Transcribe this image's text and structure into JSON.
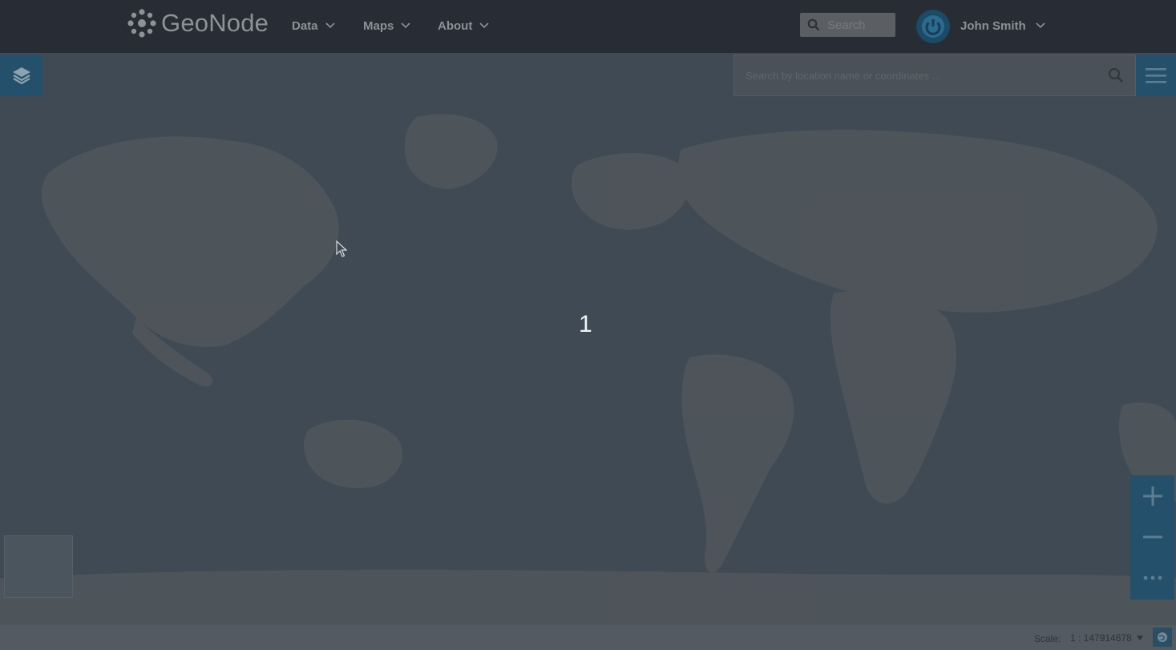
{
  "header": {
    "brand": "GeoNode",
    "nav": [
      {
        "label": "Data"
      },
      {
        "label": "Maps"
      },
      {
        "label": "About"
      }
    ],
    "search_placeholder": "Search",
    "user": "John Smith"
  },
  "map": {
    "search_placeholder": "Search by location name or coordinates ...",
    "countdown": "1"
  },
  "footer": {
    "scale_label": "Scale:",
    "scale_value": "1 : 147914678"
  },
  "colors": {
    "navbar": "#272c35",
    "accent": "#24506b",
    "overlay_map": "#3f4a54"
  },
  "icons": {
    "brand": "geonode-logo-icon",
    "search": "search-icon",
    "avatar": "power-icon",
    "layers": "layers-icon",
    "menu": "hamburger-icon",
    "zoom_in": "plus-icon",
    "zoom_out": "minus-icon",
    "more": "more-icon"
  }
}
